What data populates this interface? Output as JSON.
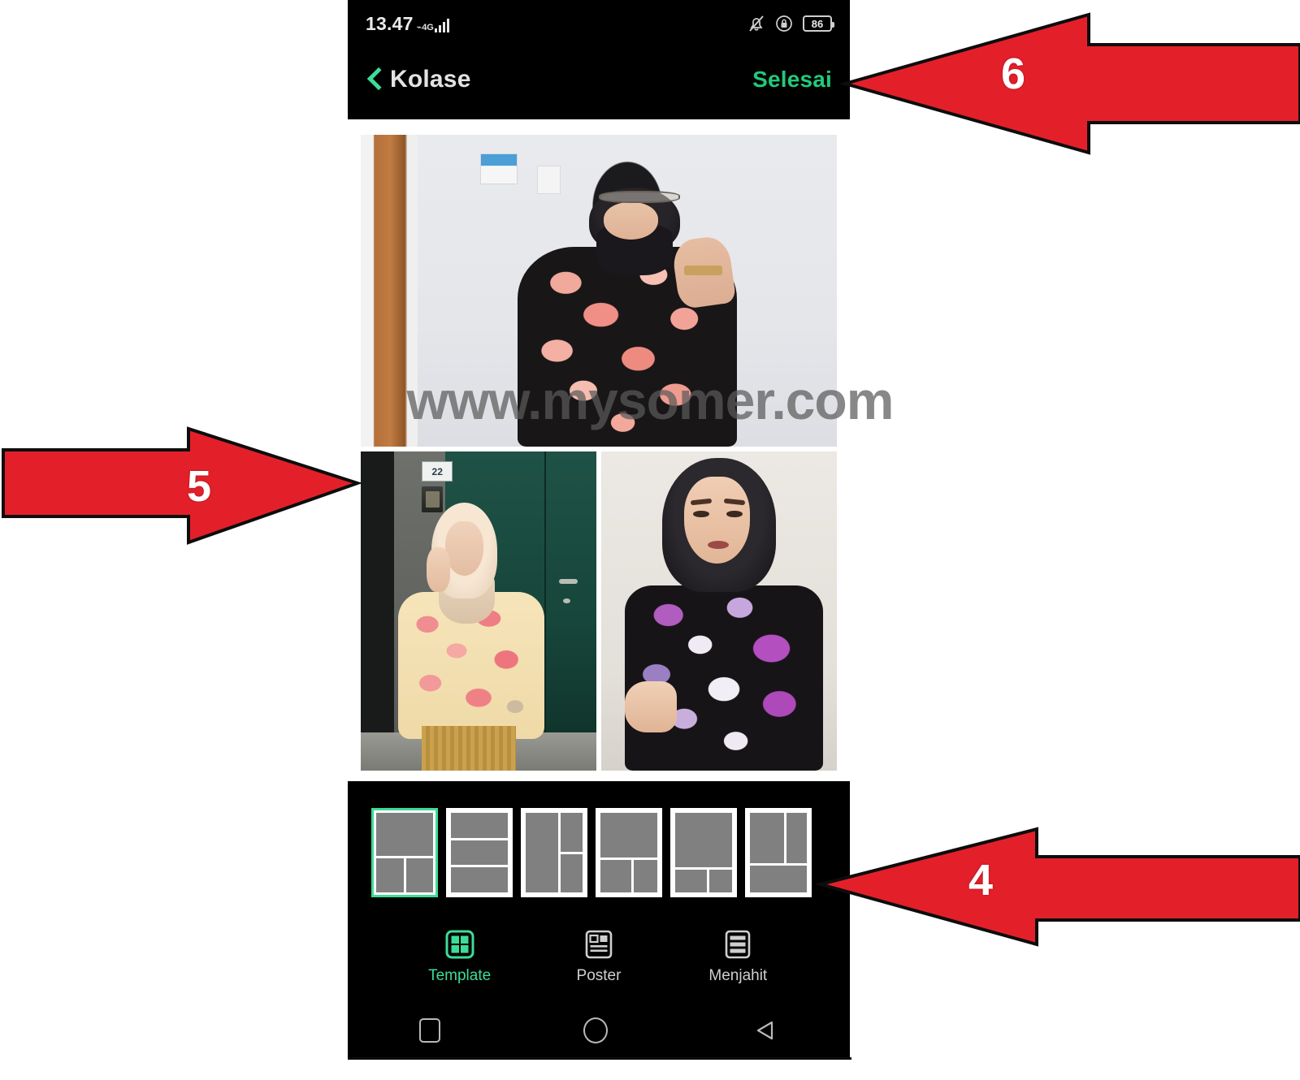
{
  "statusbar": {
    "time": "13.47",
    "network_label": "4G",
    "battery_level": "86",
    "icons": [
      "signal-bars-icon",
      "bell-muted-icon",
      "lock-circle-icon",
      "battery-icon"
    ]
  },
  "appbar": {
    "back_icon": "chevron-left-icon",
    "title": "Kolase",
    "action_label": "Selesai",
    "action_color": "#22c97a"
  },
  "watermark": {
    "text": "www.mysomer.com"
  },
  "collage": {
    "photos": [
      {
        "name": "photo-black-floral-top",
        "alt": "Woman in black hijab and pink floral blouse"
      },
      {
        "name": "photo-yellow-floral-left",
        "alt": "Woman in cream hijab and yellow floral blouse, green door, house number 22"
      },
      {
        "name": "photo-purple-floral-right",
        "alt": "Woman in black hijab and purple floral blouse"
      }
    ],
    "house_number": "22"
  },
  "templates": {
    "selected_index": 0,
    "selected_color": "#3ddc97",
    "items": [
      {
        "name": "template-1",
        "cells": 3
      },
      {
        "name": "template-2",
        "cells": 3
      },
      {
        "name": "template-3",
        "cells": 3
      },
      {
        "name": "template-4",
        "cells": 3
      },
      {
        "name": "template-5",
        "cells": 3
      },
      {
        "name": "template-6",
        "cells": 3
      }
    ]
  },
  "modes": {
    "active": "Template",
    "items": [
      {
        "label": "Template",
        "icon": "grid-four-squares-icon",
        "active": true
      },
      {
        "label": "Poster",
        "icon": "poster-layout-icon",
        "active": false
      },
      {
        "label": "Menjahit",
        "icon": "stacked-rows-icon",
        "active": false
      }
    ]
  },
  "navbar": {
    "items": [
      {
        "label": "recents",
        "icon": "square-icon"
      },
      {
        "label": "home",
        "icon": "circle-icon"
      },
      {
        "label": "back",
        "icon": "triangle-back-icon"
      }
    ]
  },
  "annotations": {
    "color": "#e3202a",
    "arrows": [
      {
        "number": "6",
        "direction": "left",
        "target": "selesai-button"
      },
      {
        "number": "5",
        "direction": "right",
        "target": "collage-preview"
      },
      {
        "number": "4",
        "direction": "left",
        "target": "template-strip"
      }
    ]
  }
}
